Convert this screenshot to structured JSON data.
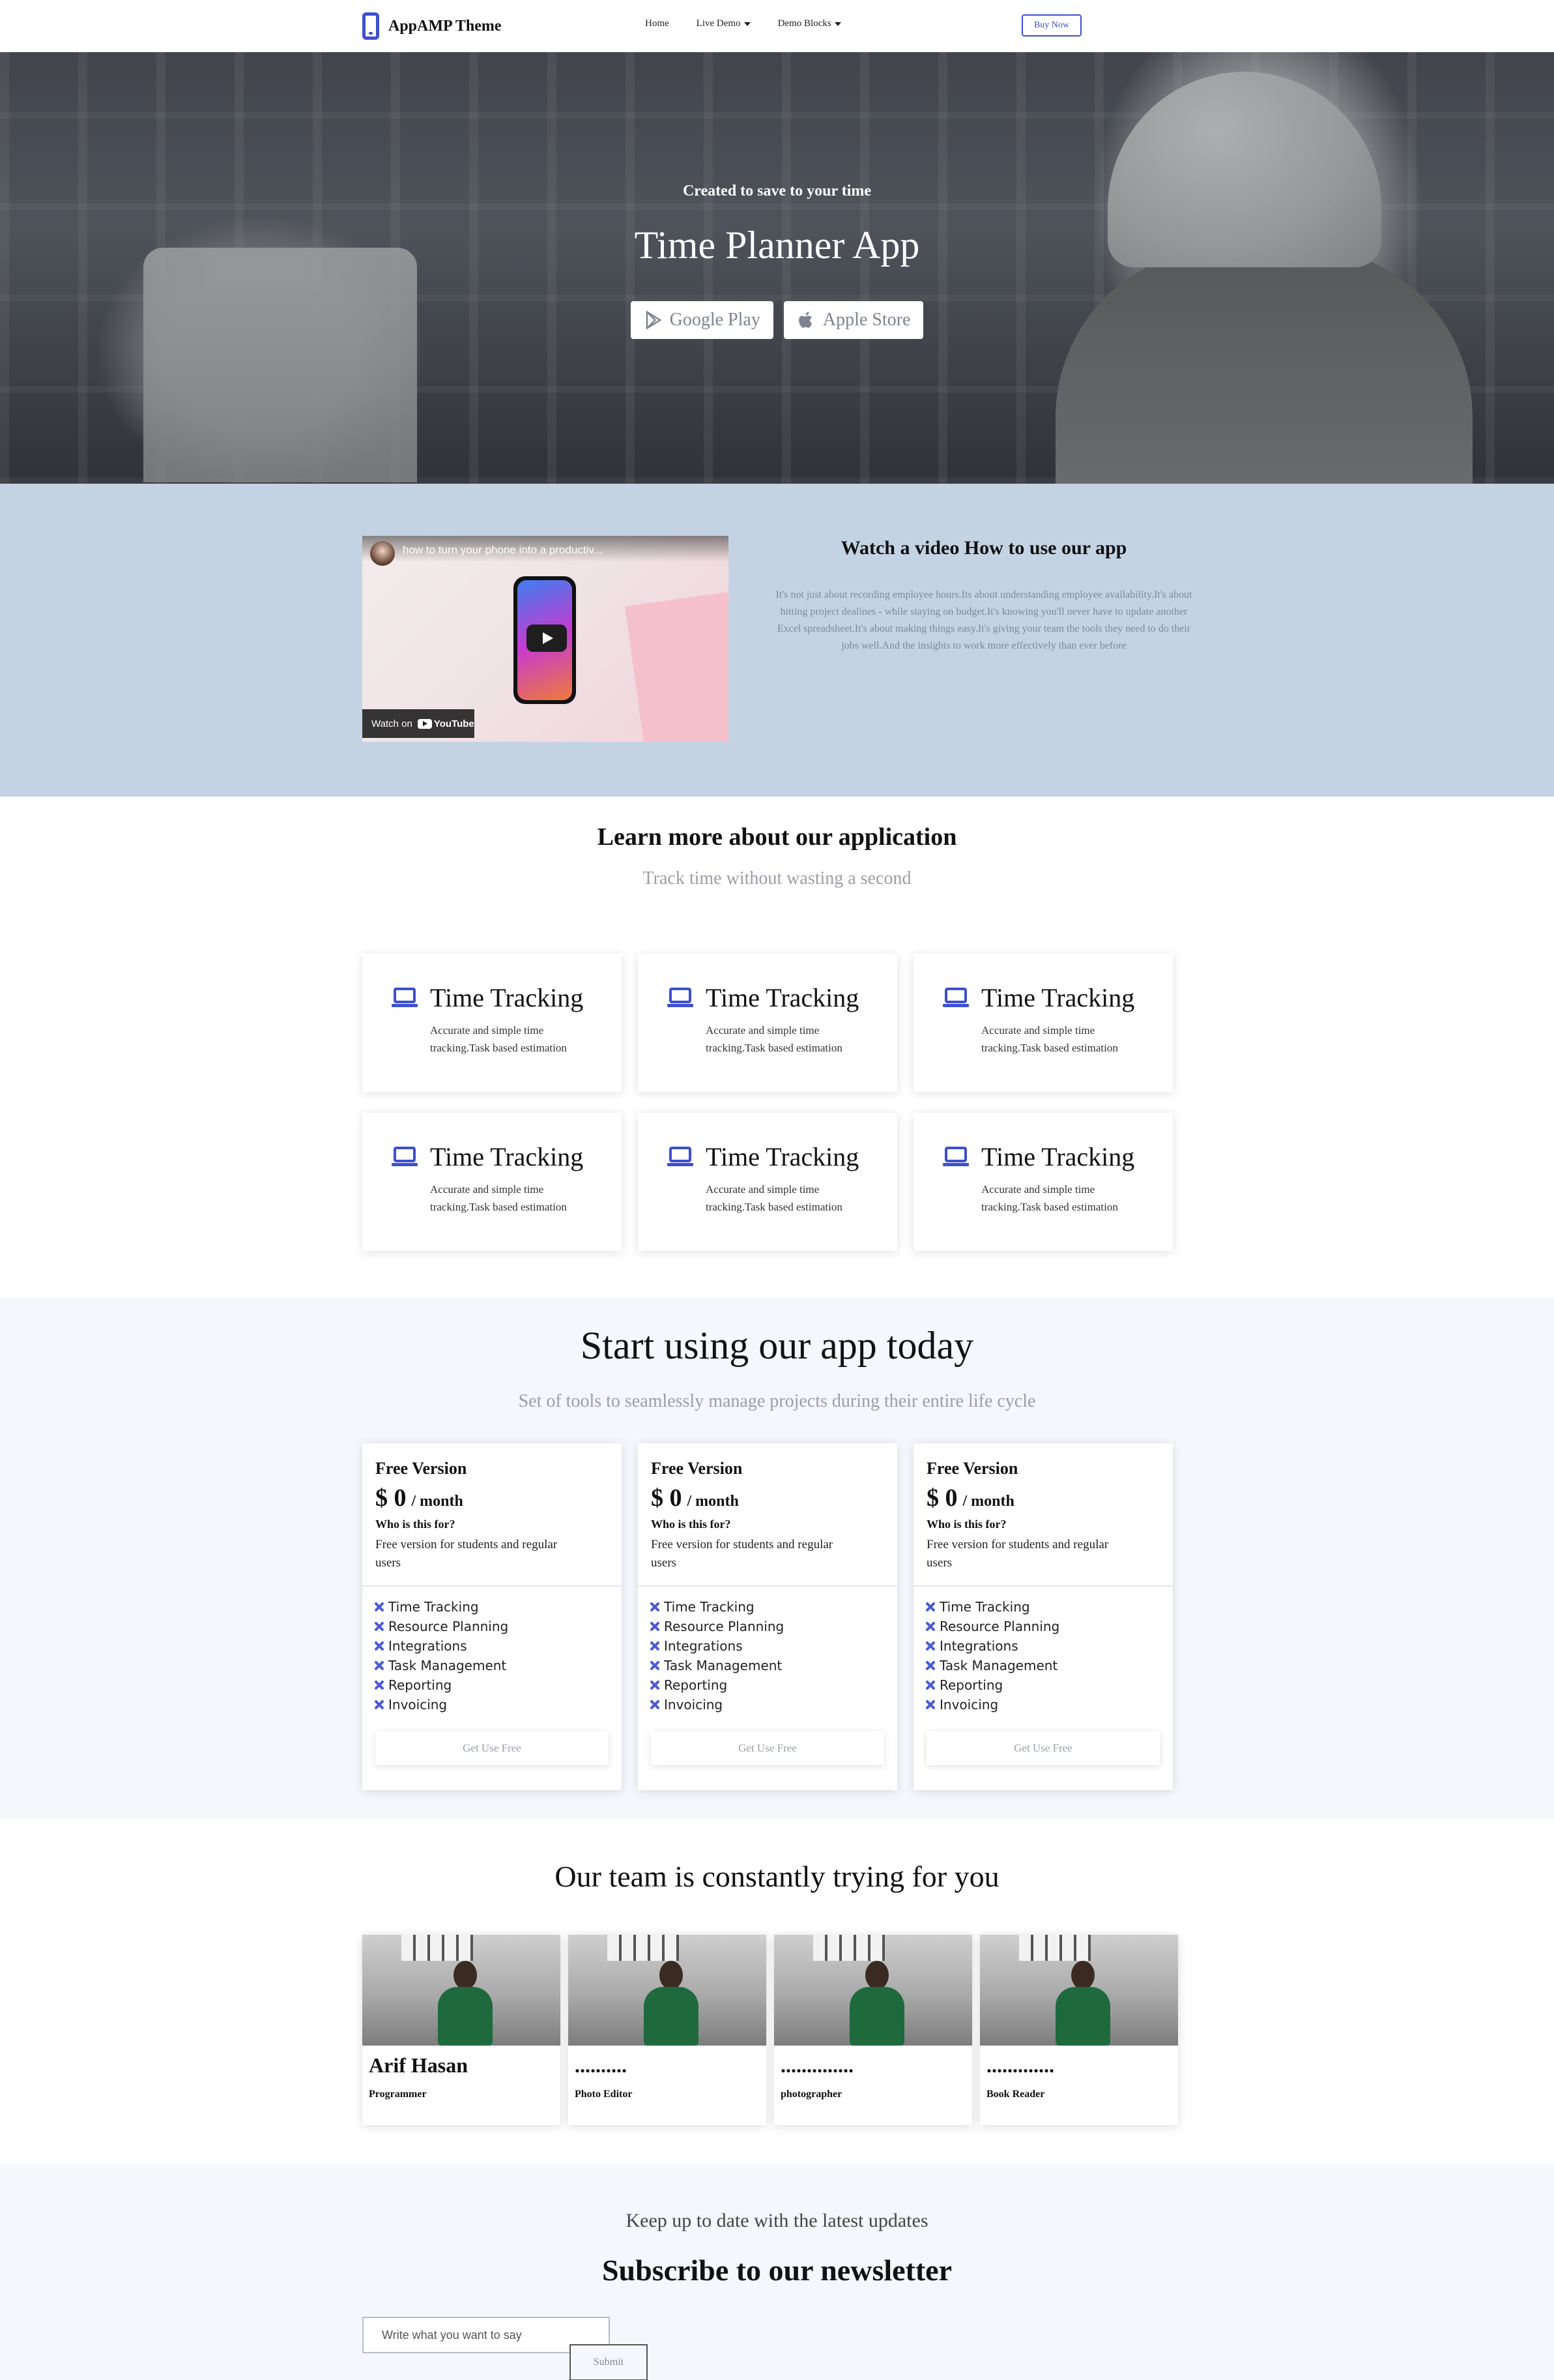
{
  "navbar": {
    "brand": "AppAMP Theme",
    "links": [
      "Home",
      "Live Demo",
      "Demo Blocks"
    ],
    "buy_button": "Buy Now"
  },
  "hero": {
    "subtitle": "Created to save to your time",
    "title": "Time Planner App",
    "buttons": [
      {
        "label": "Google Play",
        "icon": "google-play-icon"
      },
      {
        "label": "Apple Store",
        "icon": "apple-icon"
      }
    ]
  },
  "video": {
    "video_title": "how to turn your phone into a productiv...",
    "watch_on": "Watch on",
    "youtube": "YouTube",
    "heading": "Watch a video How to use our app",
    "text": "It's not just about recording employee hours.Its about understanding employee availability.It's about hitting project dealines - while staying on budget.It's knowing you'll never have to update another Excel spreadsheet.It's about making things easy.It's giving your team the tools they need to do their jobs well.And the insights to work more effectively than ever before"
  },
  "learn": {
    "title": "Learn more about our application",
    "subtitle": "Track time without wasting a second",
    "cards": [
      {
        "title": "Time Tracking",
        "desc": "Accurate and simple time tracking.Task based estimation",
        "icon": "laptop-icon"
      },
      {
        "title": "Time Tracking",
        "desc": "Accurate and simple time tracking.Task based estimation",
        "icon": "laptop-icon"
      },
      {
        "title": "Time Tracking",
        "desc": "Accurate and simple time tracking.Task based estimation",
        "icon": "laptop-icon"
      },
      {
        "title": "Time Tracking",
        "desc": "Accurate and simple time tracking.Task based estimation",
        "icon": "laptop-icon"
      },
      {
        "title": "Time Tracking",
        "desc": "Accurate and simple time tracking.Task based estimation",
        "icon": "laptop-icon"
      },
      {
        "title": "Time Tracking",
        "desc": "Accurate and simple time tracking.Task based estimation",
        "icon": "laptop-icon"
      }
    ]
  },
  "pricing": {
    "title": "Start using our app today",
    "subtitle": "Set of tools to seamlessly manage projects during their entire life cycle",
    "plans": [
      {
        "name": "Free Version",
        "price": "$ 0",
        "per": "/ month",
        "who": "Who is this for?",
        "who_desc": "Free version for students and regular users",
        "features": [
          "Time Tracking",
          "Resource Planning",
          "Integrations",
          "Task Management",
          "Reporting",
          "Invoicing"
        ],
        "button": "Get Use Free"
      },
      {
        "name": "Free Version",
        "price": "$ 0",
        "per": "/ month",
        "who": "Who is this for?",
        "who_desc": "Free version for students and regular users",
        "features": [
          "Time Tracking",
          "Resource Planning",
          "Integrations",
          "Task Management",
          "Reporting",
          "Invoicing"
        ],
        "button": "Get Use Free"
      },
      {
        "name": "Free Version",
        "price": "$ 0",
        "per": "/ month",
        "who": "Who is this for?",
        "who_desc": "Free version for students and regular users",
        "features": [
          "Time Tracking",
          "Resource Planning",
          "Integrations",
          "Task Management",
          "Reporting",
          "Invoicing"
        ],
        "button": "Get Use Free"
      }
    ]
  },
  "team": {
    "title": "Our team is constantly trying for you",
    "members": [
      {
        "name": "Arif Hasan",
        "role": "Programmer"
      },
      {
        "name": "..........",
        "role": "Photo Editor"
      },
      {
        "name": "..............",
        "role": "photographer"
      },
      {
        "name": ".............",
        "role": "Book Reader"
      }
    ]
  },
  "newsletter": {
    "subtitle": "Keep up to date with the latest updates",
    "title": "Subscribe to our newsletter",
    "placeholder": "Write what you want to say",
    "submit": "Submit"
  },
  "colors": {
    "accent": "#3d4fd1",
    "video_bg": "#c4d3e4",
    "section_bg": "#f5f7fc"
  }
}
